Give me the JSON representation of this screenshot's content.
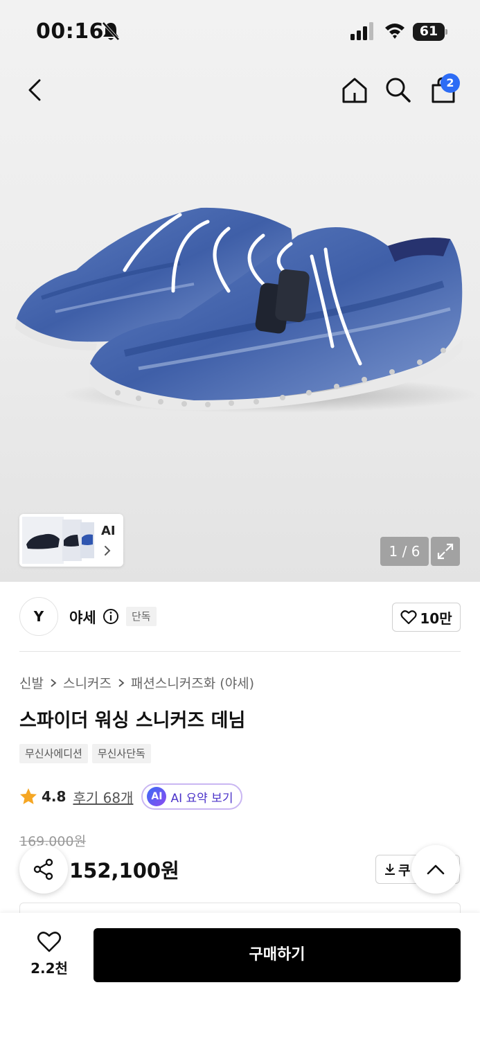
{
  "status_bar": {
    "time": "00:16",
    "battery": "61"
  },
  "nav": {
    "cart_count": "2"
  },
  "gallery": {
    "ai_label": "AI",
    "pager": "1 / 6"
  },
  "brand": {
    "logo_text": "Y",
    "name": "야세",
    "tag": "단독",
    "likes": "10만"
  },
  "breadcrumb": [
    "신발",
    "스니커즈",
    "패션스니커즈화 (야세)"
  ],
  "product": {
    "title": "스파이더 워싱 스니커즈 데님",
    "tags": [
      "무신사에디션",
      "무신사단독"
    ],
    "rating": "4.8",
    "review_link": "후기 68개",
    "ai_badge": "AI",
    "ai_summary": "AI 요약 보기",
    "original_price": "169,000원",
    "price": "152,100원",
    "coupon_label": "쿠"
  },
  "bottom_bar": {
    "wish_count": "2.2천",
    "buy_label": "구매하기"
  },
  "colors": {
    "accent_blue": "#2d6cf5",
    "star": "#f5a623",
    "ai_purple": "#4b33c9",
    "denim": "#3f5fa8"
  }
}
